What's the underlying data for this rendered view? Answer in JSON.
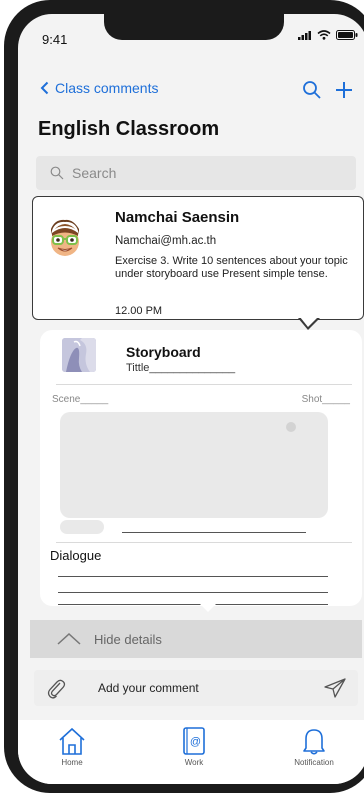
{
  "status": {
    "time": "9:41"
  },
  "nav": {
    "back_label": "Class comments"
  },
  "page": {
    "title": "English Classroom"
  },
  "search": {
    "placeholder": "Search"
  },
  "comment": {
    "author": "Namchai Saensin",
    "email": "Namchai@mh.ac.th",
    "message": "Exercise 3. Write 10 sentences about your topic under storyboard use Present simple tense.",
    "time": "12.00 PM"
  },
  "storyboard": {
    "title": "Storyboard",
    "subtitle": "Tittle______________",
    "scene_label": "Scene_____",
    "shot_label": "Shot_____",
    "dialogue_label": "Dialogue"
  },
  "details": {
    "hide_label": "Hide details"
  },
  "compose": {
    "placeholder": "Add your comment"
  },
  "tabs": [
    {
      "label": "Home",
      "icon": "home-icon"
    },
    {
      "label": "Work",
      "icon": "work-book-icon"
    },
    {
      "label": "Notification",
      "icon": "bell-icon"
    }
  ],
  "colors": {
    "accent": "#1e6fd9",
    "frame": "#1b1b1b",
    "background": "#f3f3f3"
  }
}
